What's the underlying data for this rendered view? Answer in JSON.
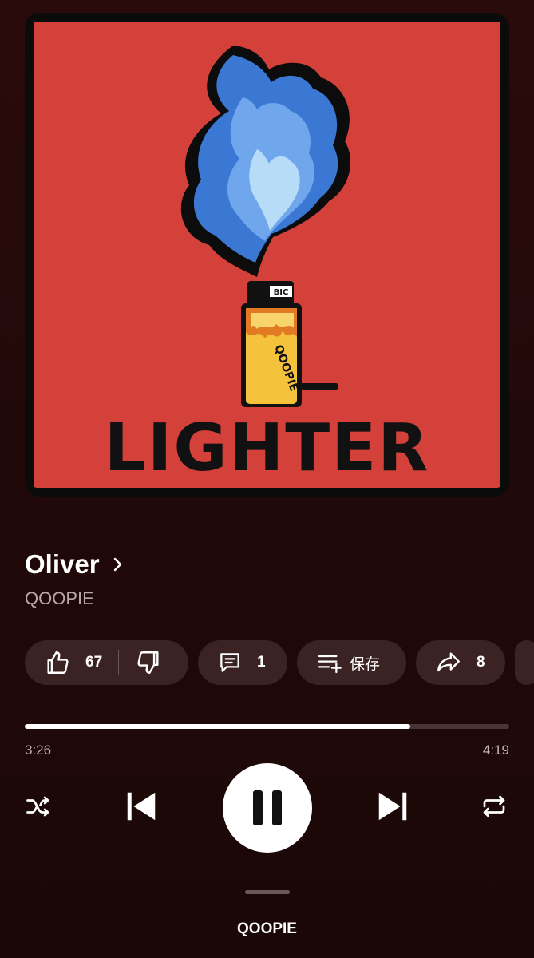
{
  "album_art": {
    "text": "LIGHTER",
    "lighter_label": "QOOPIE",
    "lighter_brand": "BIC"
  },
  "track": {
    "title": "Oliver",
    "artist": "QOOPIE"
  },
  "actions": {
    "like_count": "67",
    "comment_count": "1",
    "save_label": "保存",
    "share_count": "8"
  },
  "playback": {
    "current_time": "3:26",
    "total_time": "4:19",
    "progress_fraction": 0.795,
    "state": "playing"
  },
  "bottom_bar": {
    "label": "QOOPIE"
  },
  "colors": {
    "background": "#2a0b0b",
    "art_red": "#d3413a",
    "pill": "#3b2323",
    "accent": "#ffffff"
  }
}
